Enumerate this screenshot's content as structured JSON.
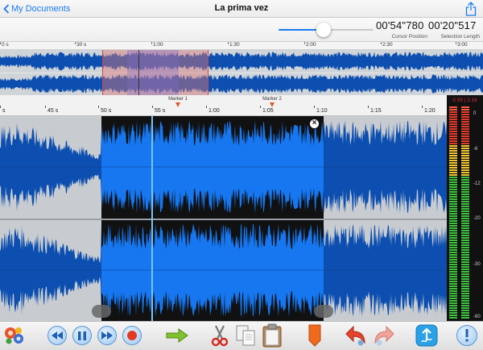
{
  "nav": {
    "back_label": "My Documents",
    "title": "La prima vez"
  },
  "info": {
    "cursor_position": "00'54\"780",
    "cursor_position_label": "Cursor Position",
    "selection_length": "00'20\"517",
    "selection_length_label": "Selection Length",
    "zoom_slider_value": 0.5
  },
  "overview_ruler": {
    "ticks": [
      "0 s",
      "30 s",
      "1:00",
      "1:30",
      "2:00",
      "2:30",
      "3:00"
    ]
  },
  "detail_ruler": {
    "ticks": [
      "s",
      "45 s",
      "50 s",
      "55 s",
      "1:00",
      "1:05",
      "1:10",
      "1:15",
      "1:20"
    ]
  },
  "markers": [
    {
      "label": "Marker 1"
    },
    {
      "label": "Marker 2"
    }
  ],
  "meter": {
    "time_readout": "0.59 | 3.16",
    "scale": [
      "0",
      "-6",
      "-12",
      "-20",
      "-30",
      "-60"
    ]
  },
  "colors": {
    "waveform": "#0d4fb0",
    "selected_waveform": "#1677f0",
    "selection_background": "#111111",
    "accent": "#1a7cf5",
    "marker": "#e05a2a"
  },
  "toolbar": {
    "icons": [
      "effects-icon",
      "rewind-icon",
      "pause-icon",
      "fast-forward-icon",
      "record-icon",
      "go-forward-icon",
      "cut-icon",
      "copy-icon",
      "paste-icon",
      "add-marker-icon",
      "undo-icon",
      "redo-icon",
      "export-icon",
      "info-icon"
    ]
  }
}
